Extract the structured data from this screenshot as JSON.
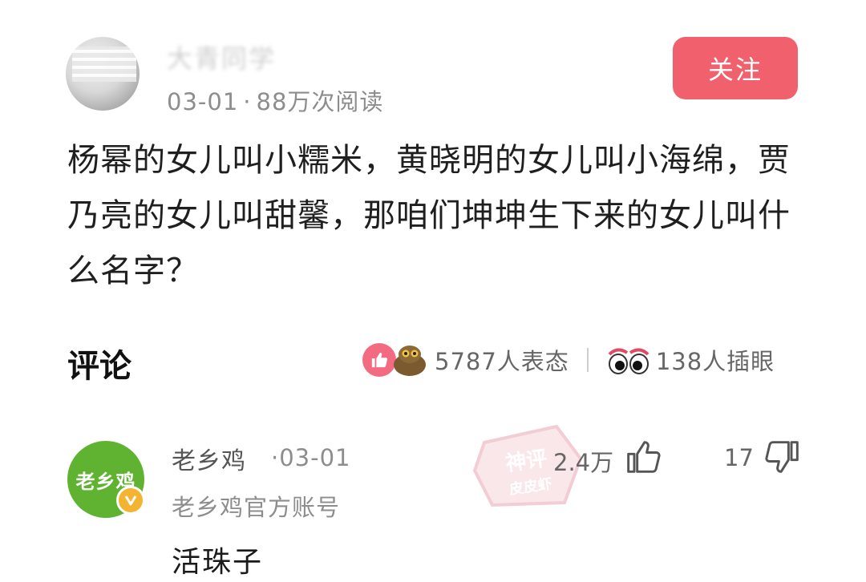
{
  "post": {
    "author": "大青同学",
    "date": "03-01",
    "views": "88万次阅读",
    "follow_label": "关注",
    "body": "杨幂的女儿叫小糯米，黄晓明的女儿叫小海绵，贾乃亮的女儿叫甜馨，那咱们坤坤生下来的女儿叫什么名字？"
  },
  "comments_section": {
    "title": "评论",
    "reactions": "5787人表态",
    "inserts": "138人插眼"
  },
  "comment": {
    "avatar_text": "老乡鸡",
    "name": "老乡鸡",
    "date": "03-01",
    "description": "老乡鸡官方账号",
    "text": "活珠子",
    "likes": "2.4万",
    "dislikes": "17"
  },
  "watermark": {
    "text_top": "神评",
    "text_bottom": "皮皮虾"
  },
  "colors": {
    "follow_button": "#f0606d",
    "like_badge": "#f36b81",
    "commenter_avatar": "#5fb331",
    "verified_badge": "#f4b431"
  },
  "icons": [
    "like-badge-icon",
    "face-emoji-icon",
    "eyes-icon",
    "thumbs-up-icon",
    "thumbs-down-icon",
    "verified-icon"
  ]
}
